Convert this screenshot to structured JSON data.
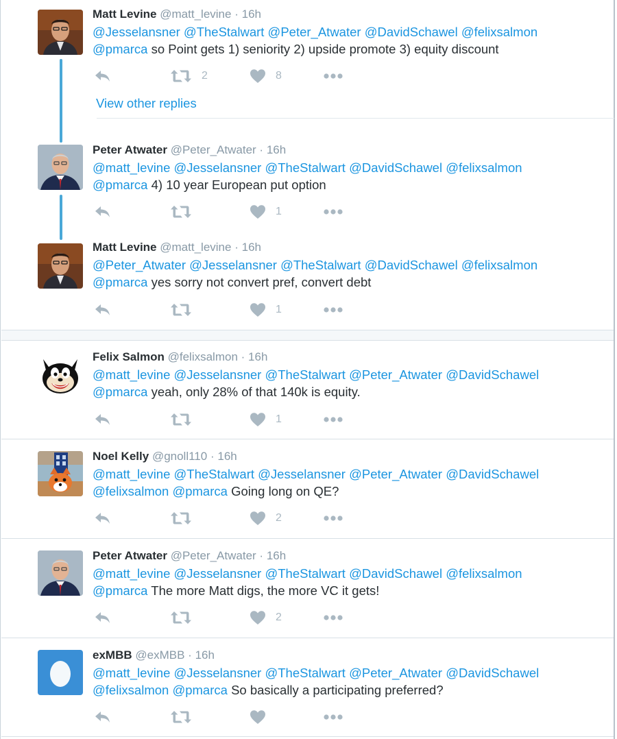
{
  "view_other_replies": "View other replies",
  "tweets": [
    {
      "name": "Matt Levine",
      "handle": "@matt_levine",
      "dot": "·",
      "time": "16h",
      "line1_mentions": "@Jesselansner @TheStalwart @Peter_Atwater @DavidSchawel @felixsalmon",
      "line2_mention": "@pmarca",
      "line2_text": " so Point gets 1) seniority 2) upside promote 3) equity discount",
      "retweets": "2",
      "likes": "8",
      "avatar": "matt-levine-photo"
    },
    {
      "name": "Peter Atwater",
      "handle": "@Peter_Atwater",
      "dot": "·",
      "time": "16h",
      "line1_mentions": "@matt_levine @Jesselansner @TheStalwart @DavidSchawel @felixsalmon",
      "line2_mention": "@pmarca",
      "line2_text": " 4) 10 year European put option",
      "retweets": "",
      "likes": "1",
      "avatar": "peter-atwater-photo"
    },
    {
      "name": "Matt Levine",
      "handle": "@matt_levine",
      "dot": "·",
      "time": "16h",
      "line1_mentions": "@Peter_Atwater @Jesselansner @TheStalwart @DavidSchawel @felixsalmon",
      "line2_mention": "@pmarca",
      "line2_text": " yes sorry not convert pref, convert debt",
      "retweets": "",
      "likes": "1",
      "avatar": "matt-levine-photo"
    },
    {
      "name": "Felix Salmon",
      "handle": "@felixsalmon",
      "dot": "·",
      "time": "16h",
      "line1_mentions": "@matt_levine @Jesselansner @TheStalwart @Peter_Atwater @DavidSchawel",
      "line2_mention": "@pmarca",
      "line2_text": " yeah, only 28% of that 140k is equity.",
      "retweets": "",
      "likes": "1",
      "avatar": "felix-the-cat-cartoon"
    },
    {
      "name": "Noel Kelly",
      "handle": "@gnoll110",
      "dot": "·",
      "time": "16h",
      "line1_mentions": "@matt_levine @TheStalwart @Jesselansner @Peter_Atwater @DavidSchawel",
      "line2_mention": "@felixsalmon @pmarca",
      "line2_text": " Going long on QE?",
      "retweets": "",
      "likes": "2",
      "avatar": "fox-and-blue-box"
    },
    {
      "name": "Peter Atwater",
      "handle": "@Peter_Atwater",
      "dot": "·",
      "time": "16h",
      "line1_mentions": "@matt_levine @Jesselansner @TheStalwart @DavidSchawel @felixsalmon",
      "line2_mention": "@pmarca",
      "line2_text": " The more Matt digs, the more VC it gets!",
      "retweets": "",
      "likes": "2",
      "avatar": "peter-atwater-photo"
    },
    {
      "name": "exMBB",
      "handle": "@exMBB",
      "dot": "·",
      "time": "16h",
      "line1_mentions": "@matt_levine @Jesselansner @TheStalwart @Peter_Atwater @DavidSchawel",
      "line2_mention": "@felixsalmon @pmarca",
      "line2_text": " So basically a participating preferred?",
      "retweets": "",
      "likes": "",
      "avatar": "default-egg-avatar"
    }
  ],
  "colors": {
    "link": "#1b95e0",
    "thread_line": "#4aa8d8",
    "action_icon": "#aab8c2",
    "egg_bg": "#3a8fd6"
  }
}
